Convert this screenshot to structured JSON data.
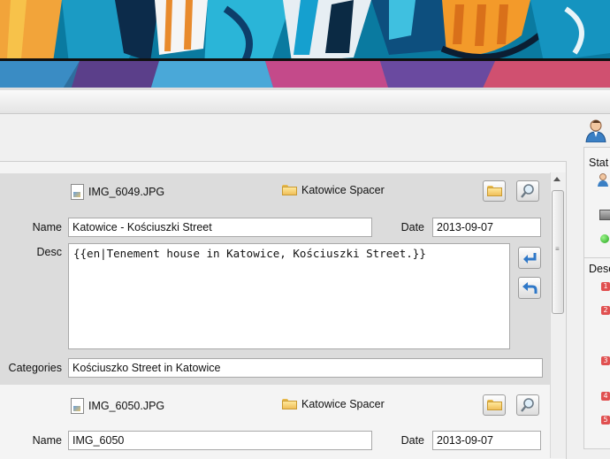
{
  "items": [
    {
      "filename": "IMG_6049.JPG",
      "folder": "Katowice Spacer",
      "name_label": "Name",
      "name_value": "Katowice - Kościuszki Street",
      "date_label": "Date",
      "date_value": "2013-09-07",
      "desc_label": "Desc",
      "desc_value": "{{en|Tenement house in Katowice, Kościuszki Street.}}",
      "categories_label": "Categories",
      "categories_value": "Kościuszko Street in Katowice"
    },
    {
      "filename": "IMG_6050.JPG",
      "folder": "Katowice Spacer",
      "name_label": "Name",
      "name_value": "IMG_6050",
      "date_label": "Date",
      "date_value": "2013-09-07"
    }
  ],
  "right_panel": {
    "status_label": "Stat",
    "desc_label": "Desc",
    "badges": [
      "1",
      "2",
      "3",
      "4",
      "5"
    ]
  },
  "colors": {
    "accent": "#2f78c8",
    "badge": "#e05050",
    "selected_bg": "#dcdcdc"
  }
}
